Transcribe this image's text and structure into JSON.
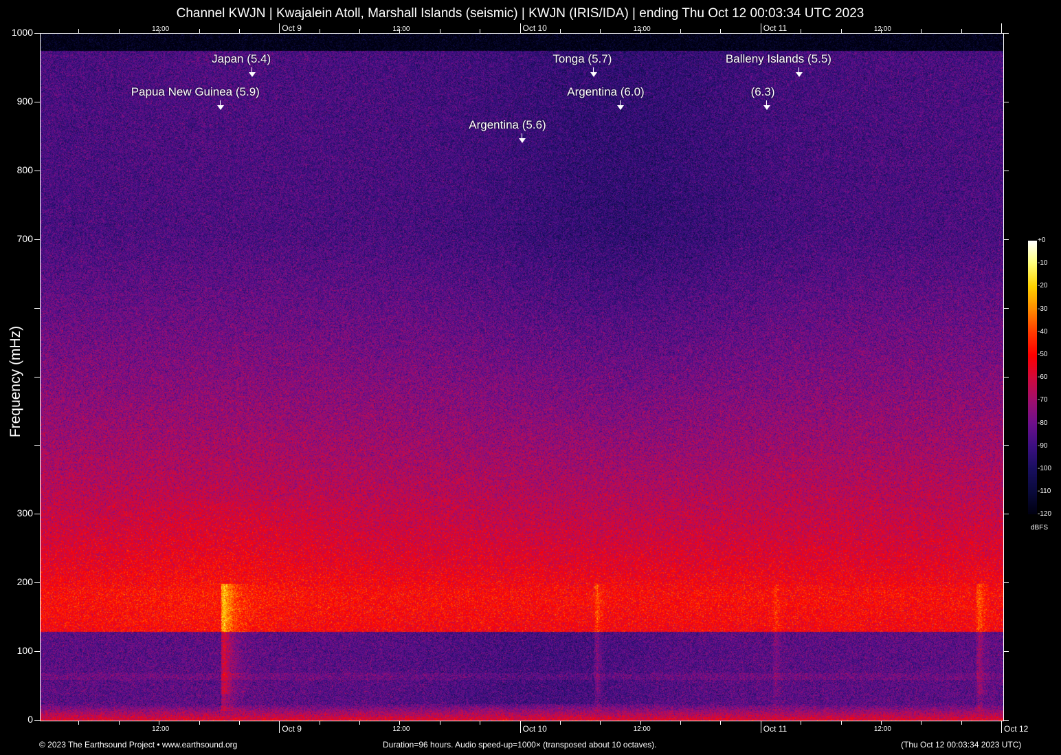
{
  "chart_data": {
    "type": "heatmap",
    "title": "Channel KWJN | Kwajalein Atoll, Marshall Islands (seismic) | KWJN (IRIS/IDA) | ending Thu Oct 12 00:03:34 UTC 2023",
    "ylabel": "Frequency (mHz)",
    "ylim": [
      0,
      1000
    ],
    "y_ticks": [
      0,
      100,
      200,
      300,
      400,
      500,
      600,
      700,
      800,
      900,
      1000
    ],
    "y_tick_labels": [
      "0",
      "100",
      "200",
      "300",
      "",
      "",
      "",
      "700",
      "800",
      "900",
      "1000"
    ],
    "x_range_hours": 96,
    "x_start": "Oct 8 00:03:34 UTC",
    "x_major_labels": [
      {
        "label": "Oct  9",
        "hours": 24
      },
      {
        "label": "Oct 10",
        "hours": 48
      },
      {
        "label": "Oct 11",
        "hours": 72
      },
      {
        "label": "Oct 12",
        "hours": 96
      }
    ],
    "x_minor_labels": [
      {
        "label": "12:00",
        "hours": 12
      },
      {
        "label": "12:00",
        "hours": 36
      },
      {
        "label": "12:00",
        "hours": 60
      },
      {
        "label": "12:00",
        "hours": 84
      }
    ],
    "colorbar": {
      "label": "dBFS",
      "range": [
        -120,
        0
      ],
      "ticks": [
        "+0",
        "-10",
        "-20",
        "-30",
        "-40",
        "-50",
        "-60",
        "-70",
        "-80",
        "-90",
        "-100",
        "-110",
        "-120"
      ]
    },
    "events": [
      {
        "label": "Japan (5.4)",
        "hours": 21.2,
        "row": 0
      },
      {
        "label": "Papua New Guinea (5.9)",
        "hours": 18.0,
        "row": 1
      },
      {
        "label": "Tonga (5.7)",
        "hours": 55.2,
        "row": 0
      },
      {
        "label": "Argentina (6.0)",
        "hours": 57.9,
        "row": 1
      },
      {
        "label": "Balleny Islands (5.5)",
        "hours": 75.7,
        "row": 0
      },
      {
        "label": "(6.3)",
        "hours": 72.5,
        "row": 1
      },
      {
        "label": "Argentina (5.6)",
        "hours": 48.1,
        "row": 2
      }
    ]
  },
  "footer": {
    "copyright": "© 2023 The Earthsound Project • www.earthsound.org",
    "info": "Duration=96 hours. Audio speed-up=1000× (transposed about 10 octaves).",
    "timestamp": "(Thu Oct 12 00:03:34 2023 UTC)"
  }
}
